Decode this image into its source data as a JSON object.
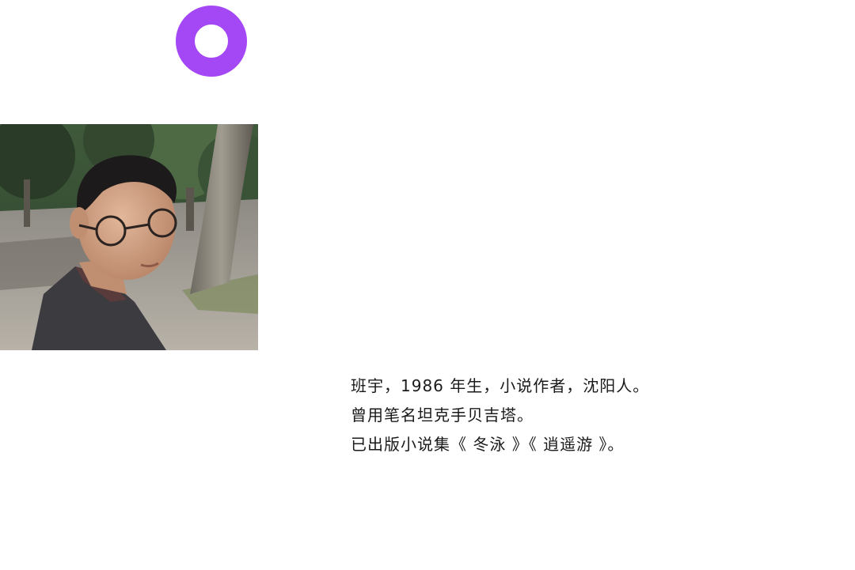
{
  "accent": {
    "ring_color": "#a447f5"
  },
  "photo": {
    "icon": "author-portrait-photo"
  },
  "bio": {
    "lines": [
      "班宇，1986 年生，小说作者，沈阳人。",
      "曾用笔名坦克手贝吉塔。",
      "已出版小说集《 冬泳 》《 逍遥游 》。"
    ]
  }
}
